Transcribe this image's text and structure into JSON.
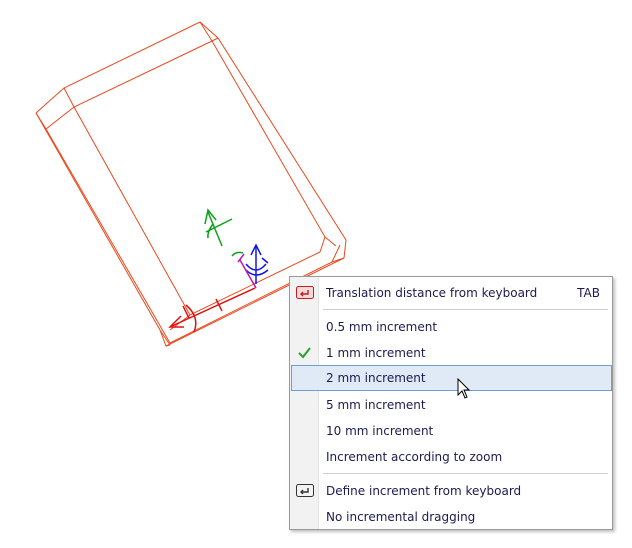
{
  "context_menu": {
    "items": [
      {
        "label": "Translation distance from keyboard",
        "shortcut": "TAB",
        "icon": "keyboard-enter-red-icon"
      },
      {
        "label": "0.5 mm increment"
      },
      {
        "label": "1 mm increment",
        "checked": true,
        "icon": "checkmark-icon"
      },
      {
        "label": "2 mm increment",
        "hovered": true
      },
      {
        "label": "5 mm increment"
      },
      {
        "label": "10 mm increment"
      },
      {
        "label": "Increment according to zoom"
      },
      {
        "label": "Define increment from keyboard",
        "icon": "keyboard-enter-icon"
      },
      {
        "label": "No incremental dragging"
      }
    ]
  },
  "colors": {
    "model_edges": "#e8491f",
    "gizmo_x": "#e01010",
    "gizmo_y": "#0aa21a",
    "gizmo_z": "#1414e0",
    "gizmo_pivot": "#c014c0",
    "check_green": "#2aa02a",
    "hover_bg": "#dfeaf6",
    "hover_border": "#6aa0d6"
  }
}
